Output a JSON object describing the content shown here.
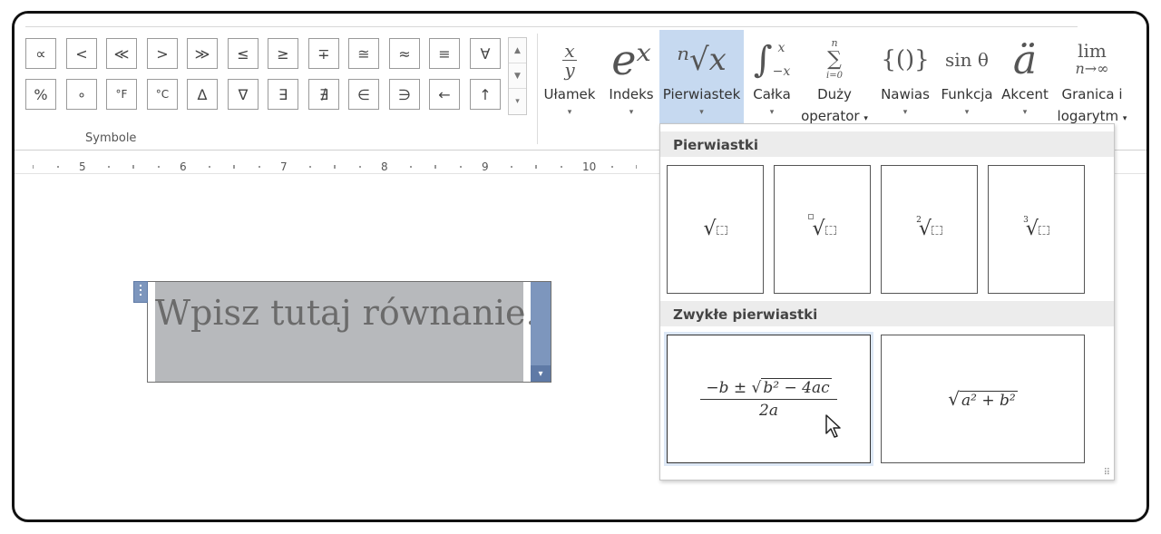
{
  "symbols": {
    "row1": [
      "∝",
      "<",
      "≪",
      ">",
      "≫",
      "≤",
      "≥",
      "∓",
      "≅",
      "≈",
      "≡",
      "∀"
    ],
    "row2": [
      "%",
      "∘",
      "°F",
      "°C",
      "∆",
      "∇",
      "∃",
      "∄",
      "∈",
      "∋",
      "←",
      "↑"
    ],
    "group_label": "Symbole",
    "scroll_up": "▲",
    "scroll_down": "▼",
    "scroll_more": "▾"
  },
  "ribbon_buttons": [
    {
      "label": "Ułamek",
      "glyph_top": "x",
      "glyph_bottom": "y"
    },
    {
      "label": "Indeks",
      "glyph": "eˣ"
    },
    {
      "label": "Pierwiastek",
      "glyph": "ⁿ√x",
      "active": true
    },
    {
      "label": "Całka",
      "glyph": "∫",
      "glyph_top": "x",
      "glyph_bottom": "−x"
    },
    {
      "label": "Duży",
      "label2": "operator",
      "glyph": "∑",
      "glyph_top": "n",
      "glyph_bottom": "i=0"
    },
    {
      "label": "Nawias",
      "glyph": "{()}"
    },
    {
      "label": "Funkcja",
      "glyph": "sin θ"
    },
    {
      "label": "Akcent",
      "glyph": "ä"
    },
    {
      "label": "Granica i",
      "label2": "logarytm",
      "glyph": "lim",
      "glyph_bottom": "n→∞"
    }
  ],
  "dropdown_arrow": "▾",
  "ruler": {
    "numbers": [
      "5",
      "6",
      "7",
      "8",
      "9",
      "10"
    ]
  },
  "equation": {
    "placeholder": "Wpisz tutaj równanie.",
    "dropdown_icon": "▾"
  },
  "gallery": {
    "section1_title": "Pierwiastki",
    "section2_title": "Zwykłe pierwiastki",
    "tiles": [
      "square-root",
      "nth-root",
      "square-root-with-degree-2",
      "cube-root"
    ],
    "degree_2": "2",
    "degree_3": "3",
    "formula1": {
      "numerator_prefix": "−b ± ",
      "numerator_radicand": "b² − 4ac",
      "denominator": "2a"
    },
    "formula2": {
      "radicand": "a² + b²"
    },
    "radical": "√",
    "resize_grip": "⠿"
  },
  "colors": {
    "accent": "#c6d9f0",
    "selection": "#7d96bd",
    "equation_bg": "#b7b9bc"
  }
}
